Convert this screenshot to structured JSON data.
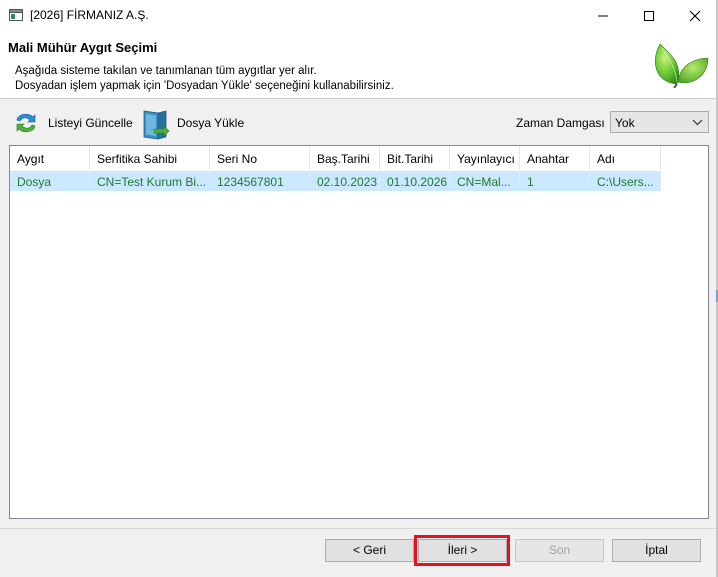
{
  "window": {
    "title": "[2026] FİRMANIZ A.Ş.",
    "icons": {
      "app": "app-window-icon",
      "minimize": "minimize-icon",
      "maximize": "maximize-icon",
      "close": "close-icon"
    }
  },
  "header": {
    "title": "Mali Mühür Aygıt Seçimi",
    "description_line1": "Aşağıda sisteme takılan ve tanımlanan tüm aygıtlar yer alır.",
    "description_line2": "Dosyadan işlem yapmak için 'Dosyadan Yükle' seçeneğini kullanabilirsiniz.",
    "logo_icon": "green-leaf-icon"
  },
  "toolbar": {
    "refresh_label": "Listeyi Güncelle",
    "refresh_icon": "refresh-arrows-icon",
    "load_label": "Dosya Yükle",
    "load_icon": "file-load-icon",
    "timestamp_label": "Zaman Damgası",
    "timestamp_value": "Yok"
  },
  "grid": {
    "columns": [
      "Aygıt",
      "Serfitika Sahibi",
      "Seri No",
      "Baş.Tarihi",
      "Bit.Tarihi",
      "Yayınlayıcı",
      "Anahtar",
      "Adı"
    ],
    "rows": [
      [
        "Dosya",
        "CN=Test Kurum Bi...",
        "1234567801",
        "02.10.2023",
        "01.10.2026",
        "CN=Mal...",
        "1",
        "C:\\Users..."
      ]
    ]
  },
  "footer": {
    "back_label": "< Geri",
    "next_label": "İleri >",
    "finish_label": "Son",
    "cancel_label": "İptal"
  },
  "colors": {
    "selection": "#cce8ff",
    "row_text": "#1b7a2e",
    "highlight": "#e8101c"
  }
}
